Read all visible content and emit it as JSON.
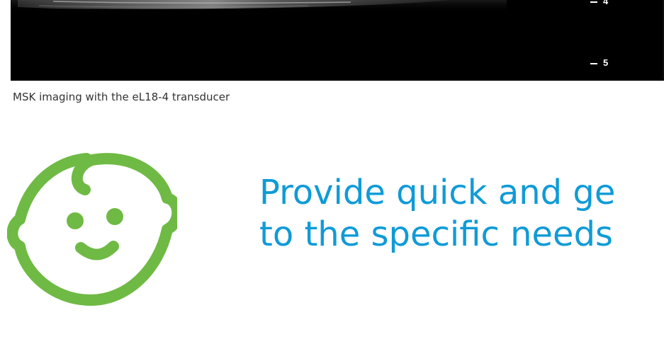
{
  "ultrasound": {
    "depth_markers": [
      "4",
      "5"
    ]
  },
  "caption": "MSK imaging with the eL18-4 transducer",
  "headline": {
    "line1": "Provide quick and ge",
    "line2": "to the specific needs"
  },
  "colors": {
    "headline": "#0f9bd7",
    "icon": "#6fba44",
    "caption": "#333333",
    "image_bg": "#000000"
  },
  "icons": {
    "baby": "baby-face-icon"
  }
}
